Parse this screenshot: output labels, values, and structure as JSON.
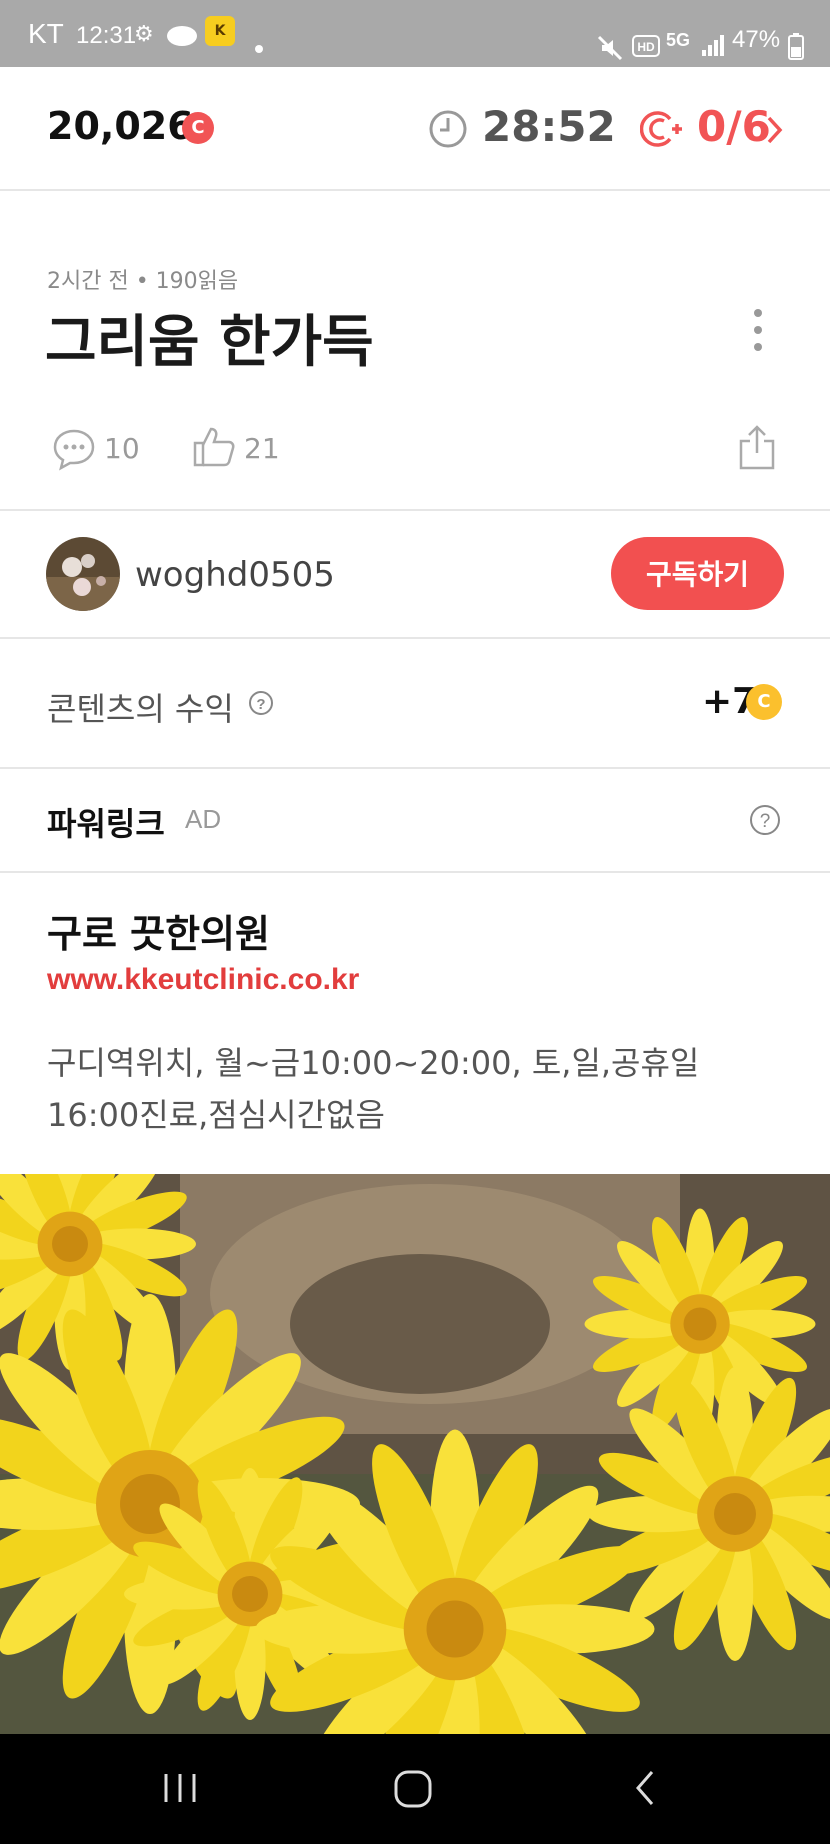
{
  "status_bar": {
    "carrier": "KT",
    "time": "12:31",
    "battery": "47%",
    "network": "5G"
  },
  "header": {
    "points": "20,026",
    "coin_label": "C",
    "timer": "28:52",
    "progress": "0/6",
    "accent_color": "#f15455"
  },
  "post": {
    "meta": "2시간 전 • 190읽음",
    "title": "그리움 한가득",
    "comments": "10",
    "likes": "21"
  },
  "author": {
    "name": "woghd0505",
    "subscribe_label": "구독하기"
  },
  "earnings": {
    "label": "콘텐츠의 수익",
    "value": "+7",
    "coin_label": "C"
  },
  "powerlink": {
    "label": "파워링크",
    "ad_tag": "AD"
  },
  "ad": {
    "title": "구로 끗한의원",
    "url": "www.kkeutclinic.co.kr",
    "desc_line1": "구디역위치, 월~금10:00~20:00, 토,일,공휴일",
    "desc_line2": "16:00진료,점심시간없음"
  },
  "icons": {
    "status": [
      "mute-icon",
      "hd-icon",
      "5g-icon",
      "signal-icon",
      "battery-icon"
    ],
    "header": [
      "coin-icon",
      "clock-icon",
      "coin-plus-icon",
      "chevron-right-icon"
    ],
    "post": [
      "more-vertical-icon",
      "comment-icon",
      "thumbs-up-icon",
      "share-icon"
    ],
    "earnings": [
      "help-icon",
      "coin-icon"
    ],
    "nav": [
      "recents-icon",
      "home-icon",
      "back-icon"
    ]
  }
}
